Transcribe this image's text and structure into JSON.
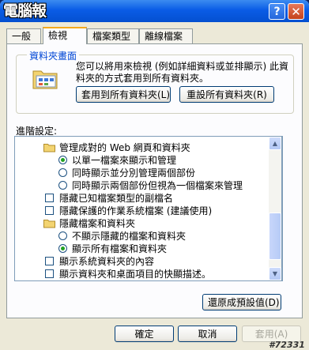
{
  "window": {
    "title": "電腦報",
    "help_glyph": "?",
    "close_glyph": "✕"
  },
  "tabs": [
    {
      "label": "一般",
      "active": false
    },
    {
      "label": "檢視",
      "active": true
    },
    {
      "label": "檔案類型",
      "active": false
    },
    {
      "label": "離線檔案",
      "active": false
    }
  ],
  "folder_view": {
    "group_title": "資料夾畫面",
    "description": "您可以將用來檢視 (例如詳細資料或並排顯示) 此資料夾的方式套用到所有資料夾。",
    "apply_all_label": "套用到所有資料夾(L)",
    "reset_all_label": "重設所有資料夾(R)"
  },
  "advanced": {
    "label": "進階設定:",
    "items": [
      {
        "kind": "folder",
        "label": "管理成對的 Web 網頁和資料夾",
        "level": 0
      },
      {
        "kind": "radio",
        "label": "以單一檔案來顯示和管理",
        "level": 1,
        "checked": true
      },
      {
        "kind": "radio",
        "label": "同時顯示並分別管理兩個部份",
        "level": 1,
        "checked": false
      },
      {
        "kind": "radio",
        "label": "同時顯示兩個部份但視為一個檔案來管理",
        "level": 1,
        "checked": false
      },
      {
        "kind": "checkbox",
        "label": "隱藏已知檔案類型的副檔名",
        "level": 0,
        "checked": false
      },
      {
        "kind": "checkbox",
        "label": "隱藏保護的作業系統檔案 (建議使用)",
        "level": 0,
        "checked": false
      },
      {
        "kind": "folder",
        "label": "隱藏檔案和資料夾",
        "level": 0
      },
      {
        "kind": "radio",
        "label": "不顯示隱藏的檔案和資料夾",
        "level": 1,
        "checked": false
      },
      {
        "kind": "radio",
        "label": "顯示所有檔案和資料夾",
        "level": 1,
        "checked": true
      },
      {
        "kind": "checkbox",
        "label": "顯示系統資料夾的內容",
        "level": 0,
        "checked": false
      },
      {
        "kind": "checkbox",
        "label": "顯示資料夾和桌面項目的快顯描述。",
        "level": 0,
        "checked": false
      }
    ],
    "restore_label": "還原成預設值(D)"
  },
  "footer": {
    "ok_label": "確定",
    "cancel_label": "取消",
    "apply_label": "套用(A)"
  },
  "watermark": "#72331",
  "colors": {
    "titlebar": "#0a5ce6",
    "accent_tab": "#f4a91c",
    "group_title": "#0046d5",
    "radio_dot": "#21a121"
  }
}
